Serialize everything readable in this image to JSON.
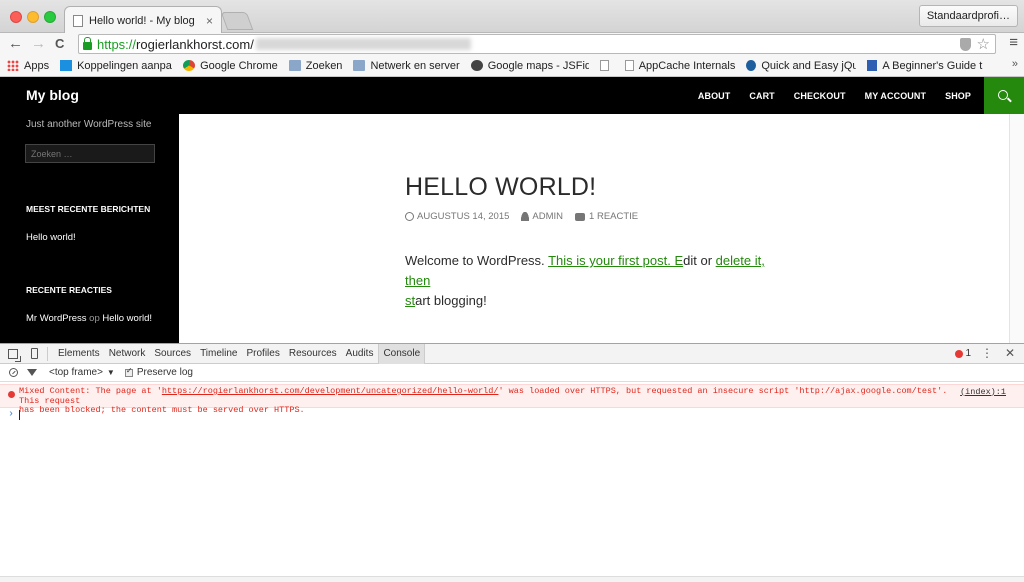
{
  "browser": {
    "tab_title": "Hello world! - My blog",
    "tab_close": "×",
    "profile_label": "Standaardprofi…",
    "url_scheme": "https://",
    "url_host": "rogierlankhorst.com/",
    "nav_back": "←",
    "nav_forward": "→",
    "nav_reload": "C",
    "menu_glyph": "≡",
    "star_glyph": "☆",
    "overflow_glyph": "»"
  },
  "bookmarks": [
    {
      "label": "Apps",
      "icon": "apps-icon"
    },
    {
      "label": "Koppelingen aanpas",
      "icon": "windows-icon"
    },
    {
      "label": "Google Chrome",
      "icon": "chrome-icon"
    },
    {
      "label": "Zoeken",
      "icon": "folder-icon"
    },
    {
      "label": "Netwerk en server",
      "icon": "folder-icon"
    },
    {
      "label": "Google maps - JSFid",
      "icon": "jsfiddle-icon"
    },
    {
      "label": "",
      "icon": "page-icon"
    },
    {
      "label": "AppCache Internals",
      "icon": "page-icon"
    },
    {
      "label": "Quick and Easy jQue",
      "icon": "jquery-icon"
    },
    {
      "label": "A Beginner's Guide t",
      "icon": "html5-icon"
    }
  ],
  "site": {
    "title": "My blog",
    "tagline": "Just another WordPress site",
    "search_placeholder": "Zoeken …",
    "nav": [
      "ABOUT",
      "CART",
      "CHECKOUT",
      "MY ACCOUNT",
      "SHOP"
    ],
    "accent": "#24890d"
  },
  "sidebar": {
    "recent_posts_title": "MEEST RECENTE BERICHTEN",
    "recent_post": "Hello world!",
    "recent_comments_title": "RECENTE REACTIES",
    "comment_author": "Mr WordPress",
    "comment_op": "op",
    "comment_post": "Hello world!"
  },
  "post": {
    "title": "HELLO WORLD!",
    "date": "AUGUSTUS 14, 2015",
    "author": "ADMIN",
    "comments": "1 REACTIE",
    "body_1": "Welcome to WordPress. ",
    "link_1": "This is your first post. E",
    "body_2": "dit or ",
    "link_2": "delete it, then",
    "link_3": "st",
    "body_3": "art blogging!"
  },
  "devtools": {
    "tabs": [
      "Elements",
      "Network",
      "Sources",
      "Timeline",
      "Profiles",
      "Resources",
      "Audits",
      "Console"
    ],
    "active_tab": "Console",
    "error_count": "1",
    "more_glyph": "⋮",
    "close_glyph": "✕",
    "frame": "<top frame>",
    "frame_caret": "▼",
    "preserve_log": "Preserve log",
    "error_line1_a": "Mixed Content: The page at '",
    "error_url": "https://rogierlankhorst.com/development/uncategorized/hello-world/",
    "error_line1_b": "' was loaded over HTTPS, but requested an insecure script 'http://ajax.google.com/test'. This request",
    "error_line2": "has been blocked; the content must be served over HTTPS.",
    "error_source": "(index):1",
    "prompt": "›"
  }
}
